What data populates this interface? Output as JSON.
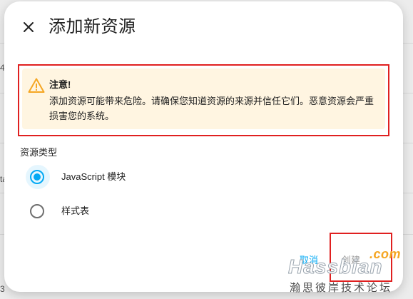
{
  "background": {
    "fragments": [
      "4",
      "ta",
      "3"
    ]
  },
  "dialog": {
    "title": "添加新资源",
    "close_icon": "close-icon"
  },
  "alert": {
    "icon": "warning-icon",
    "title": "注意!",
    "body": "添加资源可能带来危险。请确保您知道资源的来源并信任它们。恶意资源会严重损害您的系统。"
  },
  "resource_type": {
    "label": "资源类型",
    "options": [
      {
        "label": "JavaScript 模块",
        "checked": true
      },
      {
        "label": "样式表",
        "checked": false
      }
    ]
  },
  "footer": {
    "cancel_label": "取消",
    "create_label": "创建"
  },
  "watermark": {
    "com": ".com",
    "brand": "Hassbian",
    "cn": "瀚思彼岸技术论坛"
  },
  "colors": {
    "accent": "#03a9f4",
    "warning_bg": "#fff5e1",
    "warning_icon": "#f5a623",
    "annotation_outline": "#e02020"
  }
}
